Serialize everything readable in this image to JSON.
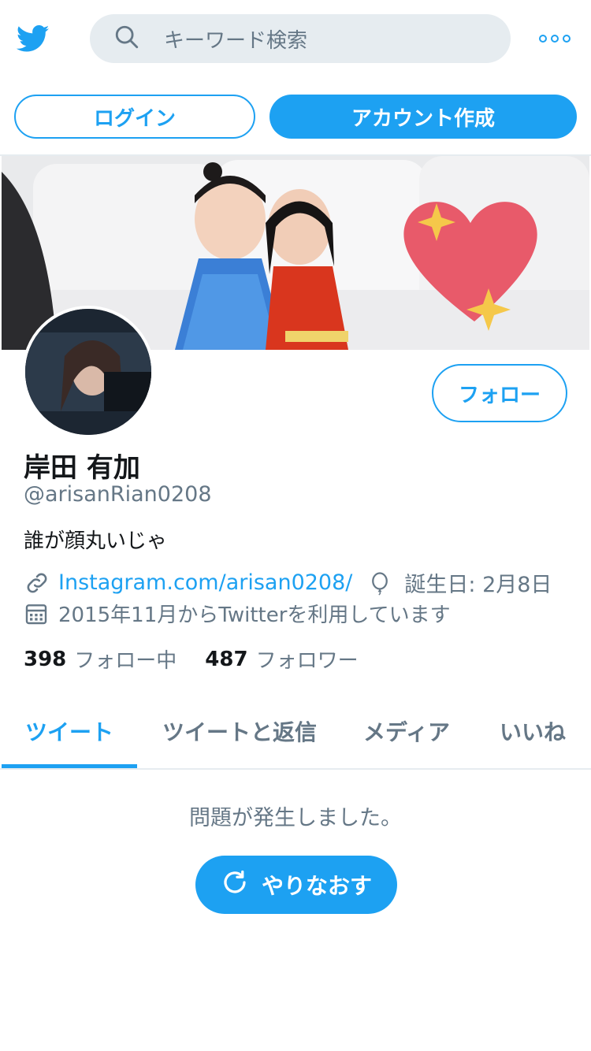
{
  "header": {
    "logo_icon": "twitter-bird-icon",
    "search_placeholder": "キーワード検索",
    "search_icon": "search-icon",
    "more_icon": "more-options-icon",
    "login_label": "ログイン",
    "signup_label": "アカウント作成"
  },
  "colors": {
    "brand": "#1da1f2",
    "text_primary": "#14171a",
    "text_secondary": "#657786",
    "divider": "#e6ecf0"
  },
  "profile": {
    "follow_label": "フォロー",
    "display_name": "岸田 有加",
    "handle": "@arisanRian0208",
    "bio": "誰が顔丸いじゃ",
    "link": "Instagram.com/arisan0208/",
    "birthday": "誕生日: 2月8日",
    "joined": "2015年11月からTwitterを利用しています",
    "following_count": "398",
    "following_label": "フォロー中",
    "followers_count": "487",
    "followers_label": "フォロワー"
  },
  "tabs": [
    {
      "label": "ツイート",
      "active": true
    },
    {
      "label": "ツイートと返信",
      "active": false
    },
    {
      "label": "メディア",
      "active": false
    },
    {
      "label": "いいね",
      "active": false
    }
  ],
  "timeline": {
    "error_message": "問題が発生しました。",
    "retry_label": "やりなおす"
  }
}
